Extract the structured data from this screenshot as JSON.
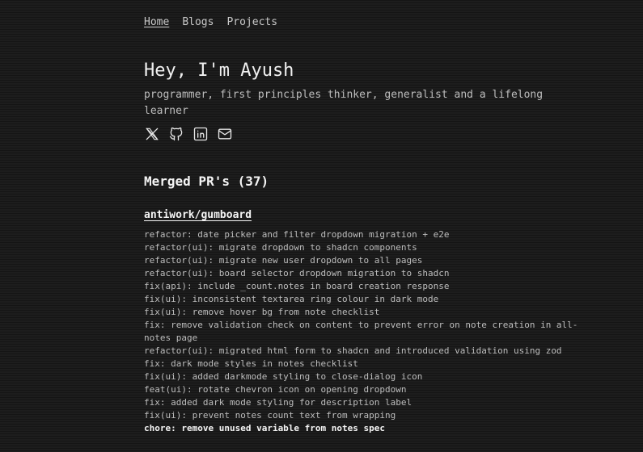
{
  "nav": {
    "items": [
      {
        "label": "Home",
        "active": true
      },
      {
        "label": "Blogs",
        "active": false
      },
      {
        "label": "Projects",
        "active": false
      }
    ]
  },
  "hero": {
    "title": "Hey, I'm Ayush",
    "subtitle": "programmer, first principles thinker, generalist and a lifelong learner"
  },
  "socials": [
    {
      "icon": "x-twitter-icon"
    },
    {
      "icon": "github-icon"
    },
    {
      "icon": "linkedin-icon"
    },
    {
      "icon": "mail-icon"
    }
  ],
  "section": {
    "title": "Merged PR's (37)"
  },
  "repo": {
    "name": "antiwork/gumboard",
    "prs": [
      "refactor: date picker and filter dropdown migration + e2e",
      "refactor(ui): migrate dropdown to shadcn components",
      "refactor(ui): migrate new user dropdown to all pages",
      "refactor(ui): board selector dropdown migration to shadcn",
      "fix(api): include _count.notes in board creation response",
      "fix(ui): inconsistent textarea ring colour in dark mode",
      "fix(ui): remove hover bg from note checklist",
      "fix: remove validation check on content to prevent error on note creation in all-notes page",
      "refactor(ui): migrated html form to shadcn and introduced validation using zod",
      "fix: dark mode styles in notes checklist",
      "fix(ui): added darkmode styling to close-dialog icon",
      "feat(ui): rotate chevron icon on opening dropdown",
      "fix: added dark mode styling for description label",
      "fix(ui): prevent notes count text from wrapping",
      "chore: remove unused variable from notes spec"
    ],
    "highlighted_index": 14
  },
  "colors": {
    "background": "#1d1d1d",
    "text": "#d6d6d6",
    "heading": "#f4f4f4",
    "muted": "#bdbdbd"
  }
}
